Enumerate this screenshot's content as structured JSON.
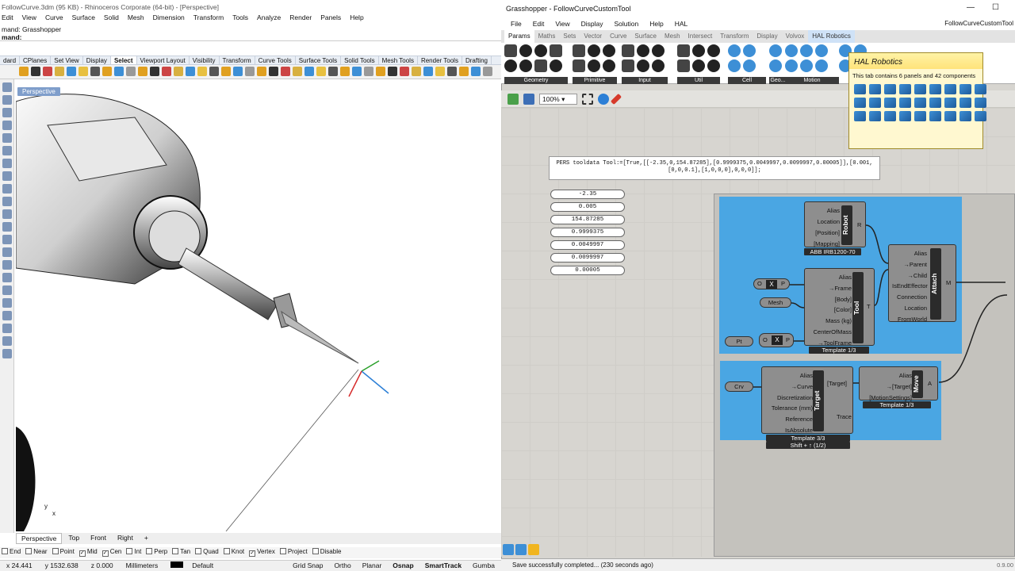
{
  "rhino": {
    "title": "FollowCurve.3dm (95 KB) - Rhinoceros Corporate (64-bit) - [Perspective]",
    "menu": [
      "Edit",
      "View",
      "Curve",
      "Surface",
      "Solid",
      "Mesh",
      "Dimension",
      "Transform",
      "Tools",
      "Analyze",
      "Render",
      "Panels",
      "Help"
    ],
    "command_history": "mand: Grasshopper",
    "command_prompt": "mand:",
    "toolbar_tabs": [
      "dard",
      "CPlanes",
      "Set View",
      "Display",
      "Select",
      "Viewport Layout",
      "Visibility",
      "Transform",
      "Curve Tools",
      "Surface Tools",
      "Solid Tools",
      "Mesh Tools",
      "Render Tools",
      "Drafting"
    ],
    "selected_tab": "Select",
    "viewport_label": "Perspective",
    "viewport_tabs": [
      "Perspective",
      "Top",
      "Front",
      "Right"
    ],
    "viewport_add": "+",
    "axis_x": "x",
    "axis_y": "y",
    "osnap": [
      {
        "label": "End",
        "checked": false
      },
      {
        "label": "Near",
        "checked": false
      },
      {
        "label": "Point",
        "checked": false
      },
      {
        "label": "Mid",
        "checked": true
      },
      {
        "label": "Cen",
        "checked": true
      },
      {
        "label": "Int",
        "checked": false
      },
      {
        "label": "Perp",
        "checked": false
      },
      {
        "label": "Tan",
        "checked": false
      },
      {
        "label": "Quad",
        "checked": false
      },
      {
        "label": "Knot",
        "checked": false
      },
      {
        "label": "Vertex",
        "checked": true
      },
      {
        "label": "Project",
        "checked": false
      },
      {
        "label": "Disable",
        "checked": false
      }
    ],
    "status": {
      "x": "x 24.441",
      "y": "y 1532.638",
      "z": "z 0.000",
      "units": "Millimeters",
      "layer": "Default",
      "toggles": [
        "Grid Snap",
        "Ortho",
        "Planar",
        "Osnap",
        "SmartTrack",
        "Gumba"
      ]
    }
  },
  "gh": {
    "title": "Grasshopper - FollowCurveCustomTool",
    "menu": [
      "File",
      "Edit",
      "View",
      "Display",
      "Solution",
      "Help",
      "HAL"
    ],
    "doc_name": "FollowCurveCustomTool",
    "tabs": [
      "Params",
      "Maths",
      "Sets",
      "Vector",
      "Curve",
      "Surface",
      "Mesh",
      "Intersect",
      "Transform",
      "Display",
      "Volvox",
      "HAL Robotics"
    ],
    "ribbon_groups": [
      "Geometry",
      "Primitive",
      "Input",
      "Util",
      "Cell",
      "Geo...",
      "Motion"
    ],
    "zoom": "100%",
    "tooltip": {
      "title": "HAL Robotics",
      "desc": "This tab contains 6 panels and 42 components"
    },
    "panel_text": "PERS tooldata Tool:=[True,[[-2.35,0,154.87285],[0.9999375,0.0049997,0.0099997,0.00005]],[0.001,[0,0,0.1],[1,0,0,0],0,0,0]];",
    "numbers": [
      "-2.35",
      "0.005",
      "154.87285",
      "0.9999375",
      "0.0049997",
      "0.0099997",
      "0.00005"
    ],
    "robot": {
      "inputs": [
        "Alias",
        "Location",
        "[Position]",
        "[Mapping]"
      ],
      "core": "Robot",
      "output": "R",
      "caption": "ABB IRB1200-70"
    },
    "tool": {
      "inputs": [
        "Alias",
        "→Frame",
        "[Body]",
        "[Color]",
        "Mass (kg)",
        "CenterOfMass",
        "→ToolFrame"
      ],
      "core": "Tool",
      "output": "T",
      "caption": "Template 1/3"
    },
    "attach": {
      "inputs": [
        "Alias",
        "→Parent",
        "→Child",
        "IsEndEffector",
        "Connection",
        "Location",
        "FromWorld"
      ],
      "core": "Attach",
      "output": "M"
    },
    "target": {
      "inputs": [
        "Alias",
        "→Curve",
        "Discretization",
        "Tolerance (mm)",
        "Reference",
        "IsAbsolute"
      ],
      "core": "Target",
      "outputs": [
        "[Target]",
        "Trace"
      ],
      "caption1": "Template 3/3",
      "caption2": "Shift + ↑ (1/2)"
    },
    "move": {
      "inputs": [
        "Alias",
        "→[Target]",
        "[MotionSettings]"
      ],
      "core": "Move",
      "output": "A",
      "caption": "Template 1/3"
    },
    "params": {
      "pt": "Pt",
      "crv": "Crv",
      "mesh": "Mesh",
      "xy_o": "O",
      "xy_p": "P"
    },
    "status_text": "Save successfully completed... (230 seconds ago)",
    "version": "0.9.00"
  },
  "colors": {
    "group_blue": "#4aa6e3",
    "canvas": "#d7d5d0",
    "component": "#8e8e8e",
    "tooltip": "#fff8d0"
  }
}
